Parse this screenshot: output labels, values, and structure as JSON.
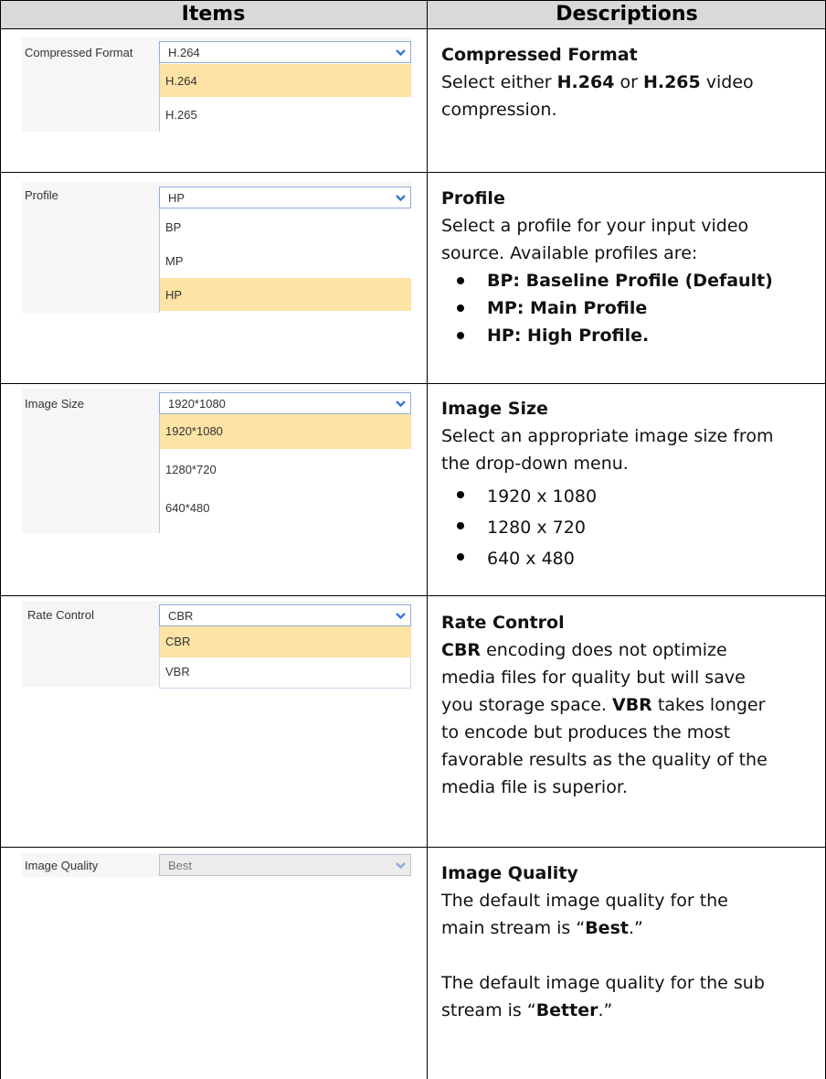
{
  "table": {
    "header": {
      "items": "Items",
      "descriptions": "Descriptions"
    }
  },
  "rows": {
    "compressed_format": {
      "label": "Compressed Format",
      "selected": "H.264",
      "options": [
        "H.264",
        "H.265"
      ],
      "title": "Compressed Format",
      "text_a": "Select either ",
      "bold_a": "H.264",
      "text_b": " or ",
      "bold_b": "H.265",
      "text_c": " video",
      "text_d": "compression."
    },
    "profile": {
      "label": "Profile",
      "selected": "HP",
      "options": [
        "BP",
        "MP",
        "HP"
      ],
      "title": "Profile",
      "line1": "Select a profile for your input video",
      "line2": "source. Available profiles are:",
      "bullets": [
        "BP: Baseline Profile (Default)",
        "MP: Main Profile",
        "HP: High Profile."
      ]
    },
    "image_size": {
      "label": "Image Size",
      "selected": "1920*1080",
      "options": [
        "1920*1080",
        "1280*720",
        "640*480"
      ],
      "title": "Image Size",
      "line1": "Select an appropriate image size from",
      "line2": "the drop-down menu.",
      "bullets": [
        "1920 x 1080",
        "1280 x 720",
        "640 x 480"
      ]
    },
    "rate_control": {
      "label": "Rate Control",
      "selected": "CBR",
      "options": [
        "CBR",
        "VBR"
      ],
      "title": "Rate Control",
      "l1_bold": "CBR",
      "l1_text": " encoding does not optimize",
      "l2": "media files for quality but will save",
      "l3_text": "you storage space. ",
      "l3_bold": "VBR",
      "l3_text2": " takes longer",
      "l4": "to encode but produces the most",
      "l5": "favorable results as the quality of the",
      "l6": "media file is superior."
    },
    "image_quality": {
      "label": "Image Quality",
      "selected": "Best",
      "title": "Image Quality",
      "p1_l1": "The default image quality for the",
      "p1_l2_a": "main stream is “",
      "p1_l2_bold": "Best",
      "p1_l2_b": ".”",
      "p2_l1": "The default image quality for the sub",
      "p2_l2_a": "stream is “",
      "p2_l2_bold": "Better",
      "p2_l2_b": ".”"
    }
  },
  "colors": {
    "header_bg": "#d9d9d9",
    "option_highlight": "#fde3a5",
    "select_border": "#8faedc",
    "arrow": "#3a78d8"
  },
  "icons": {
    "dropdown_arrow": "chevron-down-icon"
  }
}
